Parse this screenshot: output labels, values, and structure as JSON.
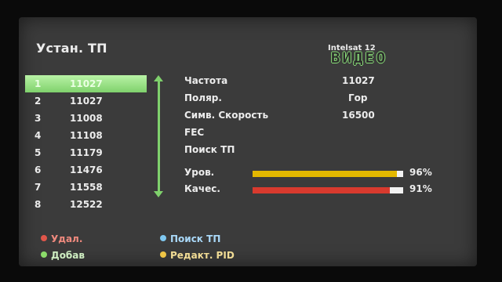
{
  "header": {
    "title": "Устан. ТП",
    "satellite": "Intelsat 12",
    "mode": "ВИДЕО"
  },
  "transponders": [
    {
      "num": "1",
      "freq": "11027"
    },
    {
      "num": "2",
      "freq": "11027"
    },
    {
      "num": "3",
      "freq": "11008"
    },
    {
      "num": "4",
      "freq": "11108"
    },
    {
      "num": "5",
      "freq": "11179"
    },
    {
      "num": "6",
      "freq": "11476"
    },
    {
      "num": "7",
      "freq": "11558"
    },
    {
      "num": "8",
      "freq": "12522"
    }
  ],
  "selected_index": 0,
  "params": {
    "frequency": {
      "label": "Частота",
      "value": "11027"
    },
    "polarization": {
      "label": "Поляр.",
      "value": "Гор"
    },
    "symbol_rate": {
      "label": "Симв. Скорость",
      "value": "16500"
    },
    "fec": {
      "label": "FEC",
      "value": ""
    },
    "tp_search": {
      "label": "Поиск ТП"
    }
  },
  "signal": {
    "level": {
      "label": "Уров.",
      "percent_text": "96%",
      "fraction": 0.96,
      "color": "#e3b800"
    },
    "quality": {
      "label": "Качес.",
      "percent_text": "91%",
      "fraction": 0.91,
      "color": "#d83a2e"
    }
  },
  "legend": {
    "delete": {
      "label": "Удал.",
      "color": "#e0564a",
      "text_color": "#f08a7e"
    },
    "add": {
      "label": "Добав",
      "color": "#8bdc6a",
      "text_color": "#cfeec2"
    },
    "search": {
      "label": "Поиск ТП",
      "color": "#7fc8f0",
      "text_color": "#a9d8f8"
    },
    "edit_pid": {
      "label": "Редакт. PID",
      "color": "#efc545",
      "text_color": "#f1dc95"
    }
  },
  "colors": {
    "accent": "#7fd16c",
    "background": "#3b3b3b"
  }
}
